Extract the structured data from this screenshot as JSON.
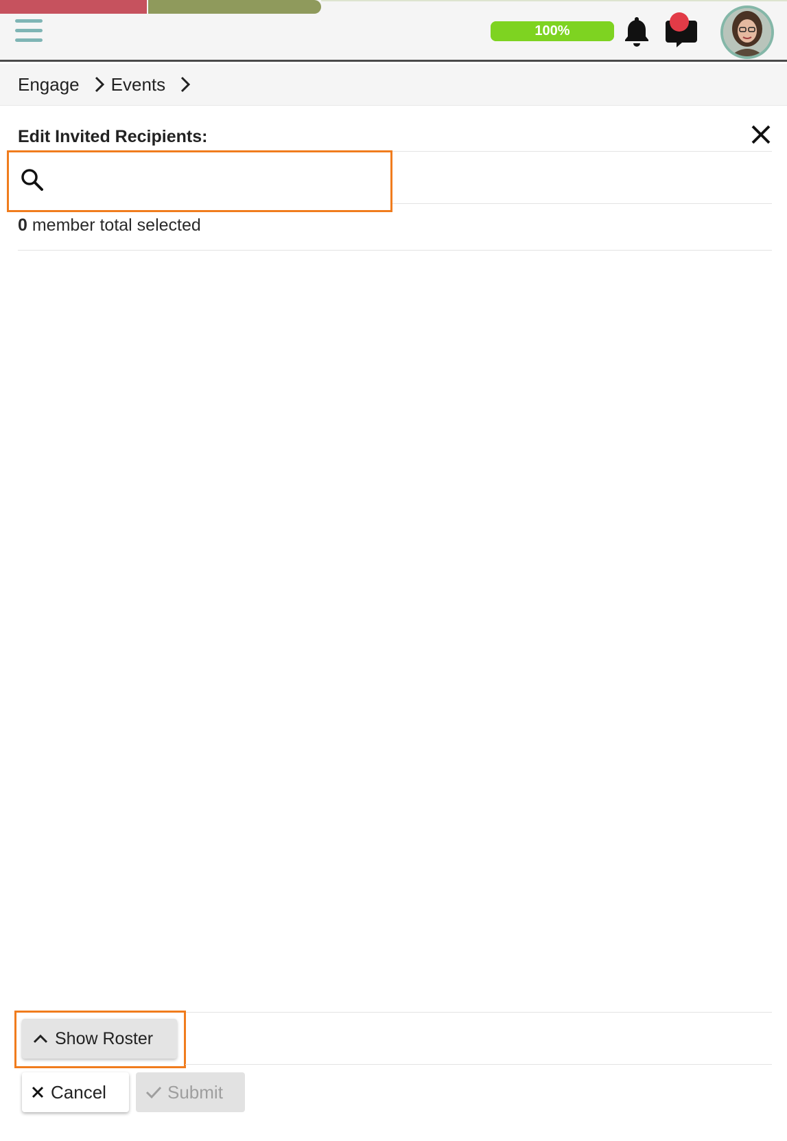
{
  "header": {
    "progress_label": "100%",
    "progress_fraction": 1.0,
    "icons": [
      "menu-icon",
      "bell-icon",
      "chat-icon",
      "avatar"
    ],
    "colors": {
      "accent_red": "#c6525e",
      "accent_olive": "#8f9a5c",
      "progress_green": "#7ed321",
      "notification_red": "#e23b47",
      "highlight_orange": "#f07c1d"
    }
  },
  "breadcrumb": {
    "items": [
      "Engage",
      "Events"
    ]
  },
  "dialog": {
    "title": "Edit Invited Recipients:",
    "search": {
      "value": "",
      "placeholder": ""
    },
    "selected_count": "0",
    "selected_text": " member total selected"
  },
  "footer": {
    "show_roster_label": "Show Roster",
    "cancel_label": "Cancel",
    "submit_label": "Submit"
  }
}
